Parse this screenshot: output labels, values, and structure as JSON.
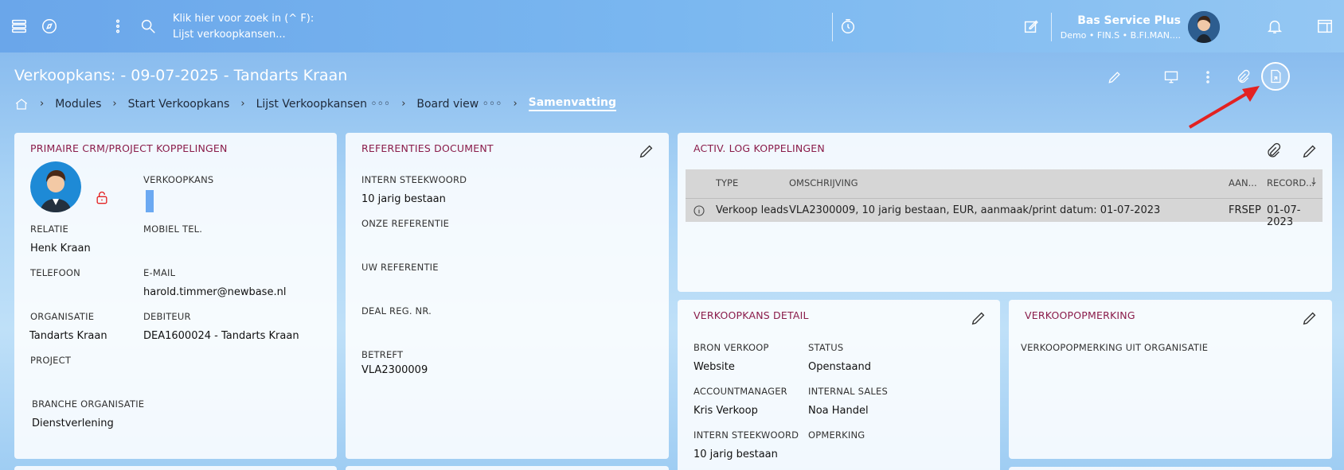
{
  "topbar": {
    "search_line1": "Klik hier voor zoek in (^ F):",
    "search_line2": "Lijst verkoopkansen...",
    "user_name": "Bas Service Plus",
    "user_sub": "Demo • FIN.S • B.FI.MAN...."
  },
  "header": {
    "title": "Verkoopkans: - 09-07-2025 - Tandarts Kraan",
    "breadcrumb": [
      "Modules",
      "Start Verkoopkans",
      "Lijst Verkoopkansen ◦◦◦",
      "Board view ◦◦◦",
      "Samenvatting"
    ]
  },
  "card_crm": {
    "title": "PRIMAIRE CRM/PROJECT KOPPELINGEN",
    "verkoopkans_label": "VERKOOPKANS",
    "relatie_label": "RELATIE",
    "relatie_value": "Henk Kraan",
    "mobiel_label": "MOBIEL TEL.",
    "telefoon_label": "TELEFOON",
    "email_label": "E-MAIL",
    "email_value": "harold.timmer@newbase.nl",
    "organisatie_label": "ORGANISATIE",
    "organisatie_value": "Tandarts Kraan",
    "debiteur_label": "DEBITEUR",
    "debiteur_value": "DEA1600024 - Tandarts Kraan",
    "project_label": "PROJECT",
    "branche_label": "BRANCHE ORGANISATIE",
    "branche_value": "Dienstverlening"
  },
  "card_ref": {
    "title": "REFERENTIES DOCUMENT",
    "intern_label": "INTERN STEEKWOORD",
    "intern_value": "10 jarig bestaan",
    "onze_label": "ONZE REFERENTIE",
    "uw_label": "UW REFERENTIE",
    "deal_label": "DEAL REG. NR.",
    "betreft_label": "BETREFT",
    "betreft_value": "VLA2300009"
  },
  "card_log": {
    "title": "ACTIV. LOG KOPPELINGEN",
    "columns": [
      "TYPE",
      "OMSCHRIJVING",
      "AAN...",
      "RECORD..."
    ],
    "row": {
      "type": "Verkoop leads",
      "omschrijving": "VLA2300009, 10 jarig bestaan, EUR, aanmaak/print datum: 01-07-2023",
      "aan": "FRSEP",
      "record": "01-07-2023"
    }
  },
  "card_detail": {
    "title": "VERKOOPKANS DETAIL",
    "bron_label": "BRON VERKOOP",
    "bron_value": "Website",
    "status_label": "STATUS",
    "status_value": "Openstaand",
    "account_label": "ACCOUNTMANAGER",
    "account_value": "Kris Verkoop",
    "internal_label": "INTERNAL SALES",
    "internal_value": "Noa Handel",
    "intern_label": "INTERN STEEKWOORD",
    "intern_value": "10 jarig bestaan",
    "opmerking_label": "OPMERKING"
  },
  "card_opm": {
    "title": "VERKOOPOPMERKING",
    "label": "VERKOOPOPMERKING UIT ORGANISATIE"
  },
  "colors": {
    "accent": "#8a1c4a",
    "arrow": "#e32222",
    "lock": "#e32222"
  }
}
